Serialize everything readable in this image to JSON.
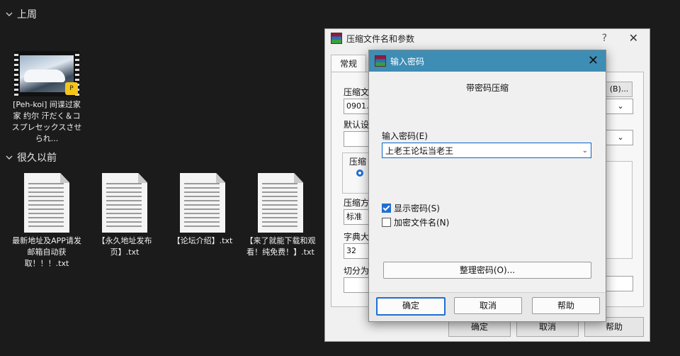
{
  "explorer": {
    "group_recent": "上周",
    "group_old": "很久以前",
    "video_file": "[Peh-koi] 间谍过家家 约尔 汗だく＆コスプレセックスさせられ...",
    "video_badge": "P",
    "files": [
      "最新地址及APP请发邮箱自动获取！！！.txt",
      "【永久地址发布页】.txt",
      "【论坛介绍】.txt",
      "【来了就能下载和观看！纯免费！】.txt"
    ]
  },
  "main_dialog": {
    "title": "压缩文件名和参数",
    "help": "?",
    "close": "✕",
    "tab_general": "常规",
    "label_archive": "压缩文",
    "archive_value": "0901.r",
    "browse_label": "(B)...",
    "label_profile": "默认设",
    "label_format": "压缩",
    "label_method": "压缩方",
    "method_value": "标准",
    "label_dict": "字典大",
    "dict_value": "32",
    "label_split": "切分为",
    "ok": "确定",
    "cancel": "取消",
    "help_btn": "帮助"
  },
  "password_dialog": {
    "title": "输入密码",
    "close": "✕",
    "heading": "带密码压缩",
    "label_password": "输入密码(E)",
    "password_value": "上老王论坛当老王",
    "show_password": "显示密码(S)",
    "encrypt_names": "加密文件名(N)",
    "organize_btn": "整理密码(O)...",
    "ok": "确定",
    "cancel": "取消",
    "help": "帮助"
  }
}
